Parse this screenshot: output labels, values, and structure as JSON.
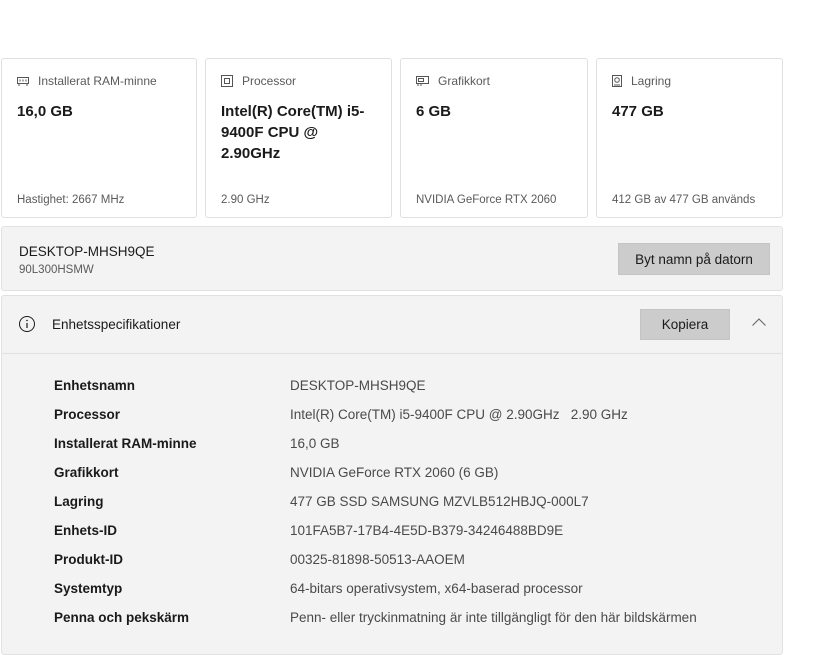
{
  "cards": [
    {
      "icon": "ram-icon",
      "label": "Installerat RAM-minne",
      "value": "16,0 GB",
      "footer": "Hastighet: 2667 MHz"
    },
    {
      "icon": "processor-icon",
      "label": "Processor",
      "value": "Intel(R) Core(TM) i5-9400F CPU @ 2.90GHz",
      "footer": "2.90 GHz"
    },
    {
      "icon": "graphics-card-icon",
      "label": "Grafikkort",
      "value": "6 GB",
      "footer": "NVIDIA GeForce RTX 2060"
    },
    {
      "icon": "storage-icon",
      "label": "Lagring",
      "value": "477 GB",
      "footer": "412 GB av 477 GB används"
    }
  ],
  "device": {
    "name": "DESKTOP-MHSH9QE",
    "model": "90L300HSMW",
    "rename_label": "Byt namn på datorn"
  },
  "specs": {
    "title": "Enhetsspecifikationer",
    "copy_label": "Kopiera",
    "rows": [
      {
        "key": "Enhetsnamn",
        "value": "DESKTOP-MHSH9QE"
      },
      {
        "key": "Processor",
        "value": "Intel(R) Core(TM) i5-9400F CPU @ 2.90GHz   2.90 GHz"
      },
      {
        "key": "Installerat RAM-minne",
        "value": "16,0 GB"
      },
      {
        "key": "Grafikkort",
        "value": "NVIDIA GeForce RTX 2060 (6 GB)"
      },
      {
        "key": "Lagring",
        "value": "477 GB SSD SAMSUNG MZVLB512HBJQ-000L7"
      },
      {
        "key": "Enhets-ID",
        "value": "101FA5B7-17B4-4E5D-B379-34246488BD9E"
      },
      {
        "key": "Produkt-ID",
        "value": "00325-81898-50513-AAOEM"
      },
      {
        "key": "Systemtyp",
        "value": "64-bitars operativsystem, x64-baserad processor"
      },
      {
        "key": "Penna och pekskärm",
        "value": "Penn- eller tryckinmatning är inte tillgängligt för den här bildskärmen"
      }
    ]
  }
}
